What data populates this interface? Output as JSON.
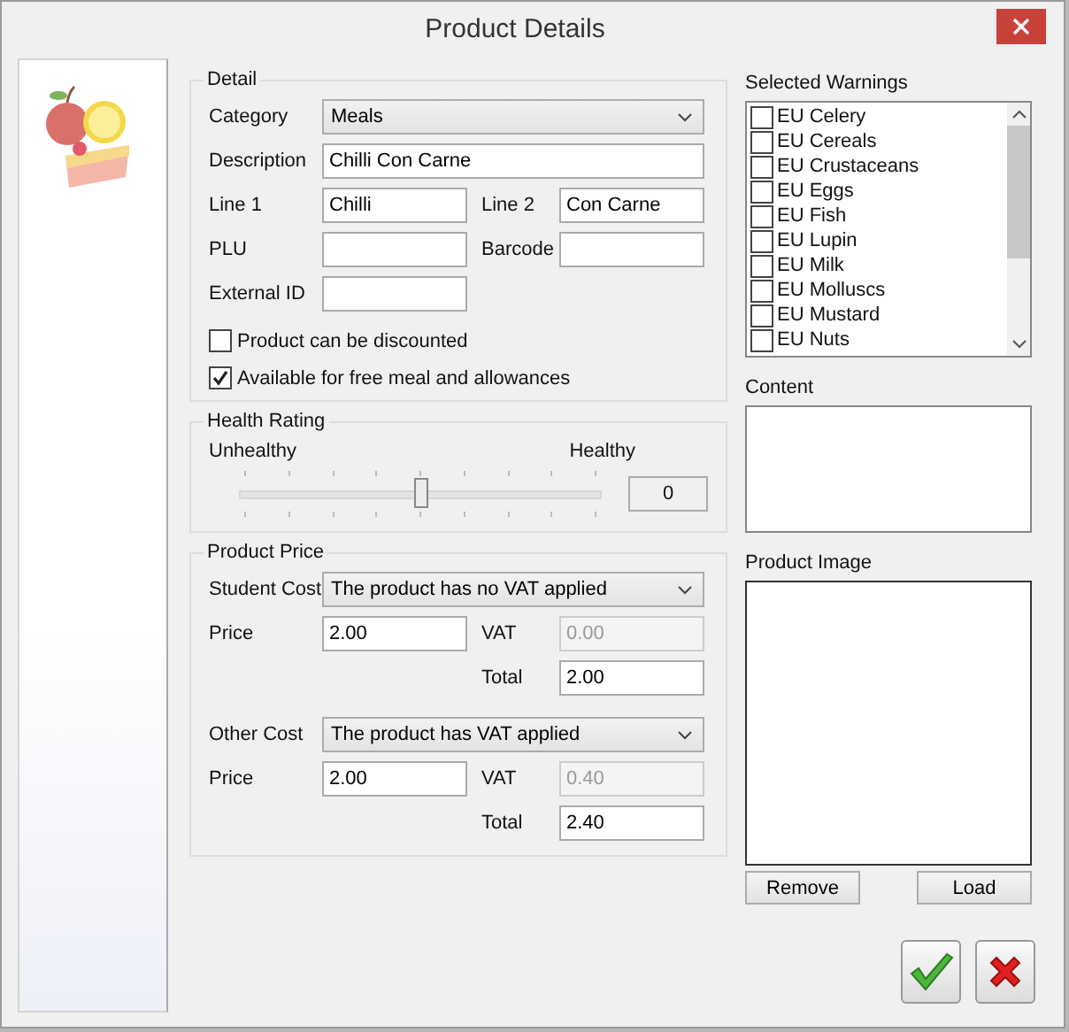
{
  "window": {
    "title": "Product Details"
  },
  "detail": {
    "legend": "Detail",
    "category": {
      "label": "Category",
      "value": "Meals"
    },
    "description": {
      "label": "Description",
      "value": "Chilli Con Carne"
    },
    "line1": {
      "label": "Line 1",
      "value": "Chilli"
    },
    "line2": {
      "label": "Line 2",
      "value": "Con Carne"
    },
    "plu": {
      "label": "PLU"
    },
    "barcode": {
      "label": "Barcode"
    },
    "external_id": {
      "label": "External ID"
    },
    "options": [
      {
        "label": "Product can be discounted",
        "checked": false
      },
      {
        "label": "Available for free meal and allowances",
        "checked": true
      }
    ]
  },
  "health_rating": {
    "legend": "Health Rating",
    "min_label": "Unhealthy",
    "max_label": "Healthy",
    "level": 0.5,
    "reading": "0"
  },
  "product_price": {
    "legend": "Product Price",
    "costs": [
      {
        "label": "Student Cost",
        "vat_mode": "The product has no VAT applied",
        "price_label": "Price",
        "price": "2.00",
        "vat_label": "VAT",
        "vat": "0.00",
        "total_label": "Total",
        "total": "2.00"
      },
      {
        "label": "Other Cost",
        "vat_mode": "The product has VAT applied",
        "price_label": "Price",
        "price": "2.00",
        "vat_label": "VAT",
        "vat": "0.40",
        "total_label": "Total",
        "total": "2.40"
      }
    ]
  },
  "warnings": {
    "label": "Selected Warnings",
    "items": [
      {
        "label": "EU Celery",
        "checked": false
      },
      {
        "label": "EU Cereals",
        "checked": false
      },
      {
        "label": "EU Crustaceans",
        "checked": false
      },
      {
        "label": "EU Eggs",
        "checked": false
      },
      {
        "label": "EU Fish",
        "checked": false
      },
      {
        "label": "EU Lupin",
        "checked": false
      },
      {
        "label": "EU Milk",
        "checked": false
      },
      {
        "label": "EU Molluscs",
        "checked": false
      },
      {
        "label": "EU Mustard",
        "checked": false
      },
      {
        "label": "EU Nuts",
        "checked": false
      }
    ]
  },
  "content": {
    "label": "Content"
  },
  "product_image": {
    "label": "Product Image",
    "buttons": [
      "Remove",
      "Load"
    ]
  }
}
